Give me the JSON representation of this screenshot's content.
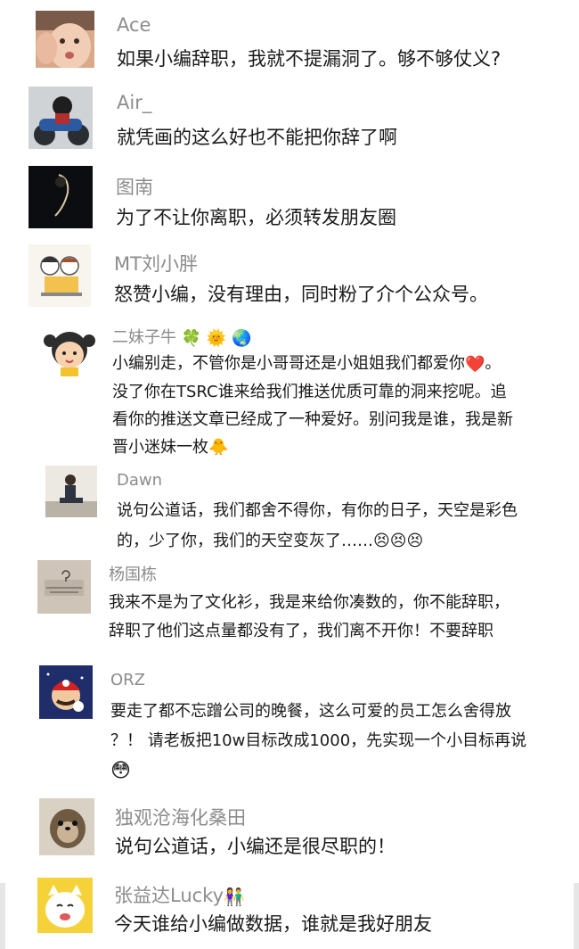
{
  "comments": [
    {
      "name": "Ace",
      "lines": [
        "如果小编辞职，我就不提漏洞了。够不够仗义?"
      ]
    },
    {
      "name": "Air_",
      "lines": [
        "就凭画的这么好也不能把你辞了啊"
      ]
    },
    {
      "name": "图南",
      "lines": [
        "为了不让你离职，必须转发朋友圈"
      ]
    },
    {
      "name": "MT刘小胖",
      "lines": [
        "怒赞小编，没有理由，同时粉了介个公众号。"
      ]
    },
    {
      "name": "二妹子牛",
      "lines": [
        "小编别走，不管你是小哥哥还是小姐姐我们都爱你",
        "没了你在TSRC谁来给我们推送优质可靠的洞来挖呢。追",
        "看你的推送文章已经成了一种爱好。别问我是谁，我是新",
        "晋小迷妹一枚"
      ]
    },
    {
      "name": "Dawn",
      "lines": [
        "说句公道话，我们都舍不得你，有你的日子，天空是彩色",
        "的，少了你，我们的天空变灰了……"
      ]
    },
    {
      "name": "杨国栋",
      "lines": [
        "我来不是为了文化衫，我是来给你凑数的，你不能辞职，",
        "辞职了他们这点量都没有了，我们离不开你！不要辞职"
      ]
    },
    {
      "name": "ORZ",
      "lines": [
        "要走了都不忘蹭公司的晚餐，这么可爱的员工怎么舍得放",
        "？！ 请老板把10w目标改成1000，先实现一个小目标再说"
      ]
    },
    {
      "name": "独观沧海化桑田",
      "lines": [
        "说句公道话，小编还是很尽职的！"
      ]
    },
    {
      "name": "张益达Lucky",
      "lines": [
        "今天谁给小编做数据，谁就是我好朋友"
      ]
    }
  ],
  "emoji": {
    "clover": "🍀",
    "sun": "🌞",
    "globe": "🌏",
    "heart": "❤️",
    "chick": "🐥",
    "sad": "😣",
    "blush": "😳",
    "couple": "👫"
  },
  "colors": {
    "name": "#8c8c8c",
    "text": "#1a1a1a"
  }
}
